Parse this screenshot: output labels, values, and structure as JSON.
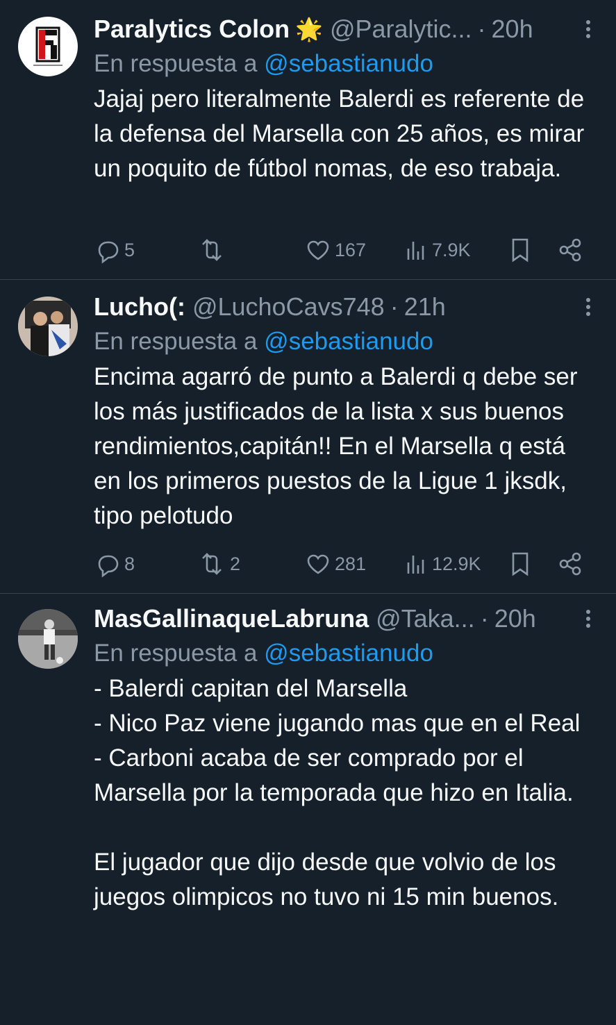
{
  "tweets": [
    {
      "name": "Paralytics Colon",
      "badge": "🌟",
      "handle": "@Paralytic...",
      "time": "20h",
      "reply_prefix": "En respuesta a",
      "reply_to": "@sebastianudo",
      "text": "Jajaj pero literalmente Balerdi es referente de la defensa del Marsella con 25 años, es mirar un poquito de fútbol nomas, de eso trabaja.",
      "replies": "5",
      "retweets": "",
      "likes": "167",
      "views": "7.9K"
    },
    {
      "name": "Lucho(:",
      "badge": "",
      "handle": "@LuchoCavs748",
      "time": "21h",
      "reply_prefix": "En respuesta a",
      "reply_to": "@sebastianudo",
      "text": "Encima agarró de punto a Balerdi q debe ser los más justificados de la lista x sus buenos rendimientos,capitán!! En el Marsella q está en los primeros puestos de la Ligue 1 jksdk, tipo pelotudo",
      "replies": "8",
      "retweets": "2",
      "likes": "281",
      "views": "12.9K"
    },
    {
      "name": "MasGallinaqueLabruna",
      "badge": "",
      "handle": "@Taka...",
      "time": "20h",
      "reply_prefix": "En respuesta a",
      "reply_to": "@sebastianudo",
      "text": "- Balerdi capitan del Marsella\n- Nico Paz viene jugando mas que en el Real\n- Carboni acaba de ser comprado por el Marsella por la temporada que hizo en Italia.\n\nEl jugador que dijo desde que volvio de los juegos olimpicos no tuvo ni 15 min buenos."
    }
  ]
}
